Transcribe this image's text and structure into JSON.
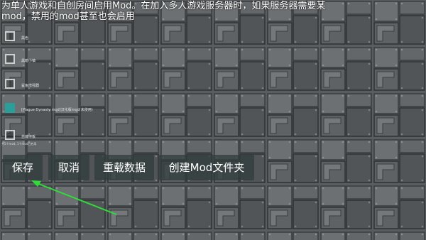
{
  "header": {
    "instructions": "为单人游戏和自创房间启用Mod。在加入多人游戏服务器时，如果服务器需要某mod，禁用的mod甚至也会启用"
  },
  "mods": [
    {
      "label": "黑色",
      "checked": false
    },
    {
      "label": "黑暗小镇",
      "checked": false
    },
    {
      "label": "鲨鱼增强器",
      "checked": false
    },
    {
      "label": "[Plague Dynasty mod]汉化版mod(未使用)",
      "checked": true
    },
    {
      "label": "自律甲板",
      "checked": false
    }
  ],
  "footer_note": "共5个mod, 1个mod已启用",
  "buttons": {
    "save": "保存",
    "cancel": "取消",
    "reload": "重载数据",
    "create_folder": "创建Mod文件夹"
  },
  "colors": {
    "accent": "#2a9e98",
    "annotation_arrow": "#2fdc3a"
  }
}
